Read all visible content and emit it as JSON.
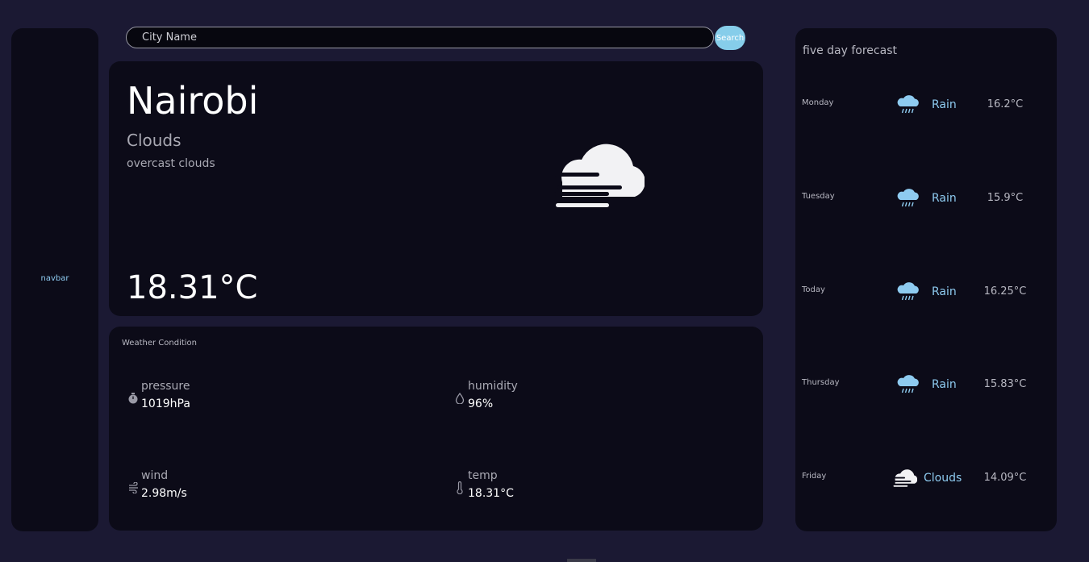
{
  "navbar": {
    "label": "navbar"
  },
  "search": {
    "placeholder": "City Name",
    "button_label": "Search"
  },
  "current": {
    "city": "Nairobi",
    "condition": "Clouds",
    "description": "overcast clouds",
    "temperature": "18.31°C",
    "icon": "fog-cloud-icon"
  },
  "conditions": {
    "title": "Weather Condition",
    "pressure": {
      "label": "pressure",
      "value": "1019hPa",
      "icon": "stopwatch-icon"
    },
    "humidity": {
      "label": "humidity",
      "value": "96%",
      "icon": "droplet-icon"
    },
    "wind": {
      "label": "wind",
      "value": "2.98m/s",
      "icon": "wind-icon"
    },
    "temp": {
      "label": "temp",
      "value": "18.31°C",
      "icon": "thermometer-icon"
    }
  },
  "forecast": {
    "title": "five day forecast",
    "days": [
      {
        "day": "Monday",
        "condition": "Rain",
        "temp": "16.2°C",
        "icon": "rain-icon"
      },
      {
        "day": "Tuesday",
        "condition": "Rain",
        "temp": "15.9°C",
        "icon": "rain-icon"
      },
      {
        "day": "Today",
        "condition": "Rain",
        "temp": "16.25°C",
        "icon": "rain-icon"
      },
      {
        "day": "Thursday",
        "condition": "Rain",
        "temp": "15.83°C",
        "icon": "rain-icon"
      },
      {
        "day": "Friday",
        "condition": "Clouds",
        "temp": "14.09°C",
        "icon": "fog-cloud-icon"
      }
    ]
  },
  "colors": {
    "background": "#1b1933",
    "panel": "#0c0b18",
    "accent": "#86cdea",
    "muted_text": "#a9a9b3"
  }
}
